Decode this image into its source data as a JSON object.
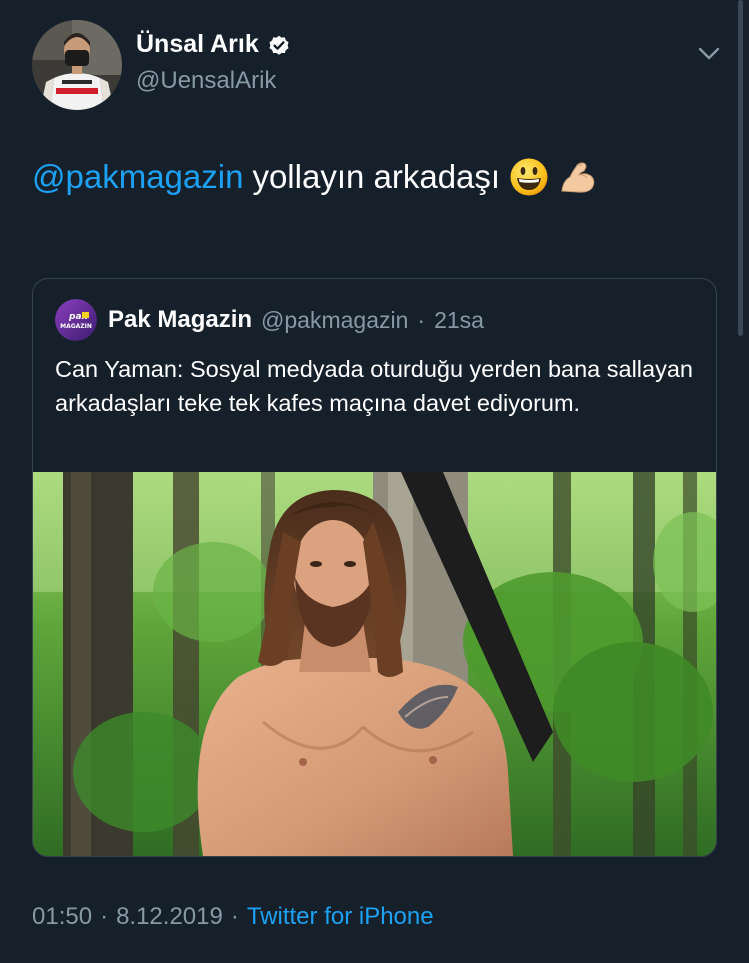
{
  "author": {
    "name": "Ünsal Arık",
    "handle": "@UensalArik",
    "verified": true
  },
  "tweet": {
    "mention": "@pakmagazin",
    "text": "yollayın arkadaşı",
    "emojis": [
      "grinning-face-emoji",
      "flexed-biceps-emoji"
    ]
  },
  "quoted_tweet": {
    "avatar_text_top": "pak",
    "avatar_text_bottom": "MAGAZIN",
    "name": "Pak Magazin",
    "handle": "@pakmagazin",
    "separator": "·",
    "time": "21sa",
    "body": "Can Yaman: Sosyal medyada oturduğu yerden bana sallayan arkadaşları teke tek kafes maçına davet ediyorum.",
    "media": "photo-long-haired-bearded-man-in-forest"
  },
  "footer": {
    "time": "01:50",
    "separator1": "·",
    "date": "8.12.2019",
    "separator2": "·",
    "source": "Twitter for iPhone"
  },
  "colors": {
    "background": "#15202b",
    "accent": "#1da1f2",
    "secondary_text": "#8899a6",
    "border": "#38444d"
  }
}
